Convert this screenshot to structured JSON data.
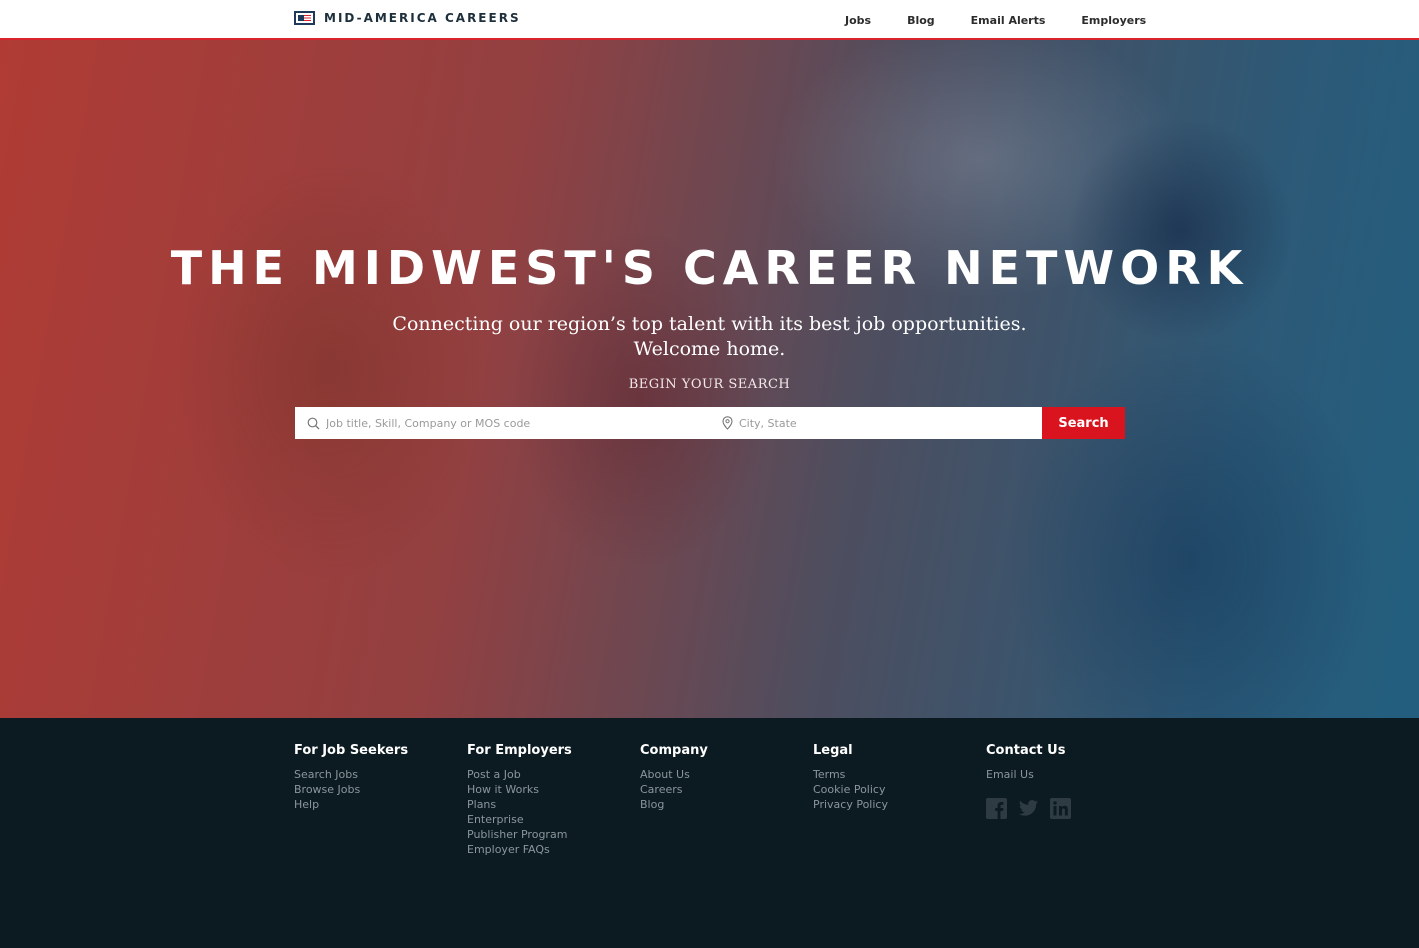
{
  "header": {
    "brand_name": "MID-AMERICA CAREERS",
    "nav": [
      "Jobs",
      "Blog",
      "Email Alerts",
      "Employers"
    ]
  },
  "hero": {
    "title": "THE MIDWEST'S CAREER NETWORK",
    "subtitle_line1": "Connecting our region’s top talent with its best job opportunities.",
    "subtitle_line2": "Welcome home.",
    "begin_label": "BEGIN YOUR SEARCH",
    "search": {
      "job_placeholder": "Job title, Skill, Company or MOS code",
      "location_placeholder": "City, State",
      "button_label": "Search"
    }
  },
  "footer": {
    "columns": [
      {
        "title": "For Job Seekers",
        "links": [
          "Search Jobs",
          "Browse Jobs",
          "Help"
        ]
      },
      {
        "title": "For Employers",
        "links": [
          "Post a Job",
          "How it Works",
          "Plans",
          "Enterprise",
          "Publisher Program",
          "Employer FAQs"
        ]
      },
      {
        "title": "Company",
        "links": [
          "About Us",
          "Careers",
          "Blog"
        ]
      },
      {
        "title": "Legal",
        "links": [
          "Terms",
          "Cookie Policy",
          "Privacy Policy"
        ]
      },
      {
        "title": "Contact Us",
        "links": [
          "Email Us"
        ]
      }
    ],
    "social_icons": [
      "facebook-icon",
      "twitter-icon",
      "linkedin-icon"
    ]
  },
  "colors": {
    "accent_red": "#d9141e",
    "footer_bg": "#0c1b21",
    "footer_link": "#8b969c",
    "brand_navy": "#1d3a5c"
  }
}
